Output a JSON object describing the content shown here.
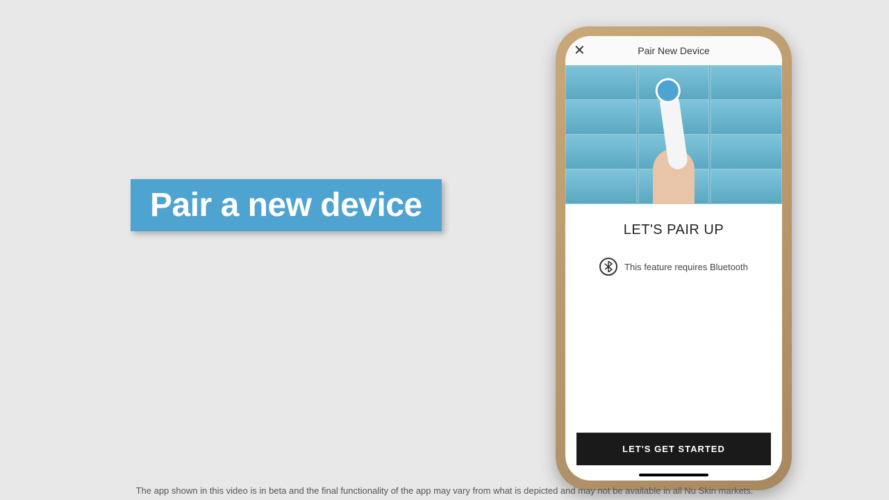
{
  "slide": {
    "title": "Pair a new device"
  },
  "phone": {
    "header": {
      "close_symbol": "✕",
      "title": "Pair New Device"
    },
    "content": {
      "heading": "LET'S PAIR UP",
      "bluetooth_text": "This feature requires Bluetooth"
    },
    "cta": {
      "label": "LET'S GET STARTED"
    }
  },
  "disclaimer": "The app shown in this video is in beta and the final functionality of the app may vary from what is depicted and may not be available in all Nu Skin markets."
}
